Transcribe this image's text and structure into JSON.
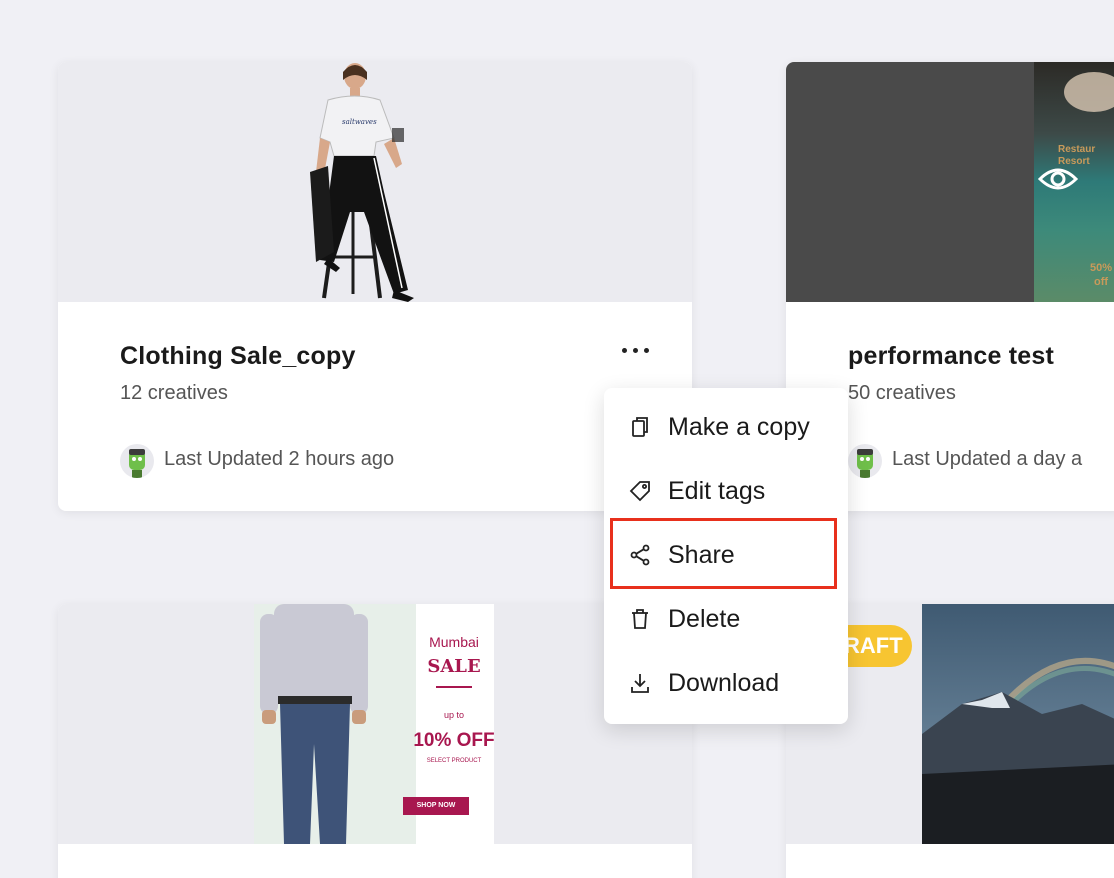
{
  "cards": [
    {
      "title": "Clothing Sale_copy",
      "count": "12 creatives",
      "updated": "Last Updated 2 hours ago",
      "thumb_text": "saltwaves"
    },
    {
      "title": "performance test",
      "count": "50 creatives",
      "updated": "Last Updated a day a"
    }
  ],
  "menu": {
    "items": [
      {
        "label": "Make a copy",
        "icon": "copy-icon"
      },
      {
        "label": "Edit tags",
        "icon": "tag-icon"
      },
      {
        "label": "Share",
        "icon": "share-icon"
      },
      {
        "label": "Delete",
        "icon": "trash-icon"
      },
      {
        "label": "Download",
        "icon": "download-icon"
      }
    ],
    "highlighted": "Share"
  },
  "banner": {
    "city": "Mumbai",
    "sale": "SALE",
    "upto": "up to",
    "offer": "10% OFF",
    "select": "SELECT PRODUCT",
    "cta": "SHOP NOW"
  },
  "perf_thumb": {
    "line1": "Restaur",
    "line2": "Resort",
    "line3": "50%",
    "line4": "off"
  },
  "draft_badge": "RAFT",
  "colors": {
    "highlight": "#e8301c",
    "draft": "#f7c531",
    "banner_accent": "#a8174f"
  }
}
